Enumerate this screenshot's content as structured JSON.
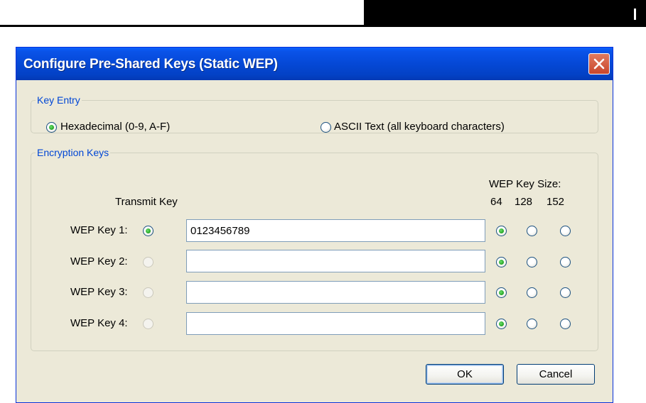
{
  "dialog": {
    "title": "Configure Pre-Shared Keys (Static WEP)"
  },
  "key_entry": {
    "legend": "Key Entry",
    "options": [
      {
        "label": "Hexadecimal (0-9, A-F)",
        "checked": true
      },
      {
        "label": "ASCII Text (all keyboard characters)",
        "checked": false
      }
    ]
  },
  "encryption_keys": {
    "legend": "Encryption Keys",
    "transmit_key_header": "Transmit Key",
    "key_size_header": "WEP Key Size:",
    "size_options": [
      "64",
      "128",
      "152"
    ],
    "keys": [
      {
        "label": "WEP Key 1:",
        "value": "0123456789",
        "transmit_enabled": true
      },
      {
        "label": "WEP Key 2:",
        "value": "",
        "transmit_enabled": false
      },
      {
        "label": "WEP Key 3:",
        "value": "",
        "transmit_enabled": false
      },
      {
        "label": "WEP Key 4:",
        "value": "",
        "transmit_enabled": false
      }
    ]
  },
  "buttons": {
    "ok": "OK",
    "cancel": "Cancel"
  }
}
